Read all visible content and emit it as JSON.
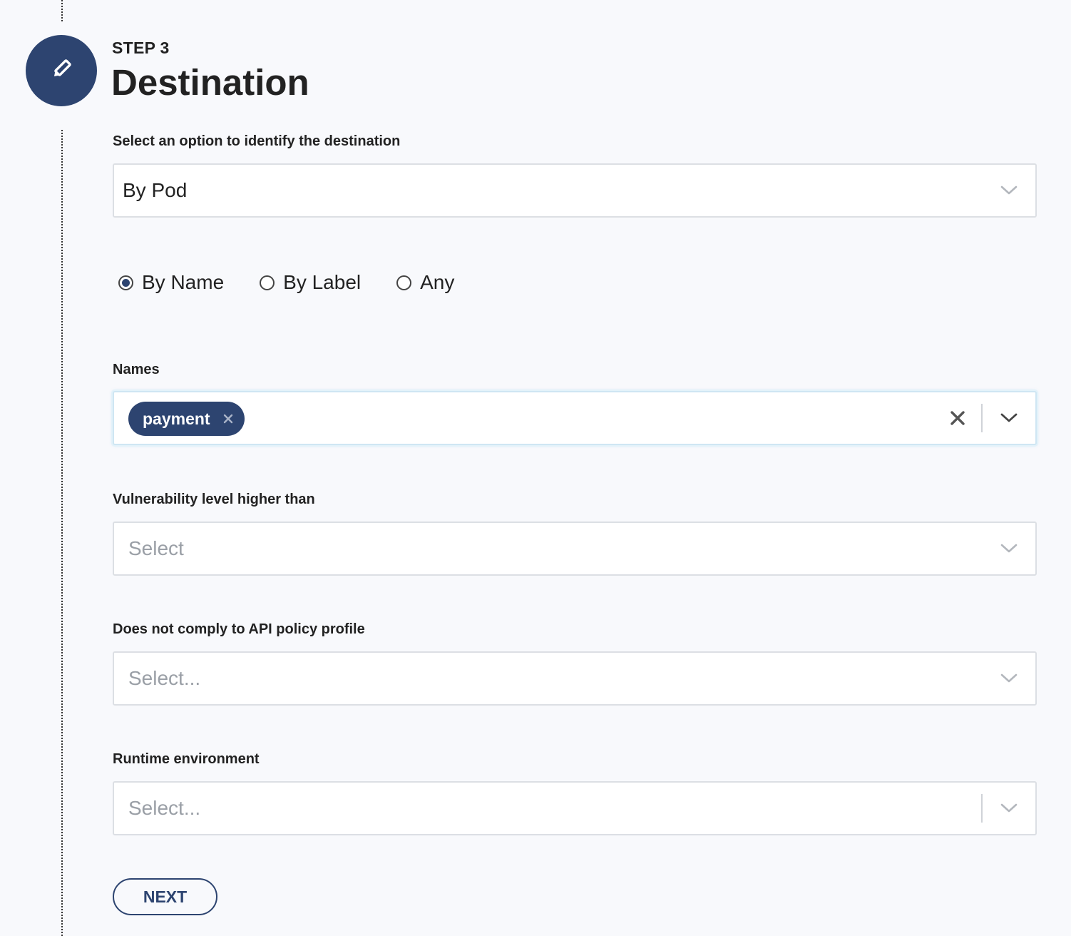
{
  "step": {
    "number_label": "STEP 3",
    "title": "Destination",
    "icon": "pencil-icon"
  },
  "identify": {
    "label": "Select an option to identify the destination",
    "value": "By Pod"
  },
  "radio_options": {
    "by_name": "By Name",
    "by_label": "By Label",
    "any": "Any",
    "selected": "By Name"
  },
  "names": {
    "label": "Names",
    "chips": [
      "payment"
    ]
  },
  "vulnerability": {
    "label": "Vulnerability level higher than",
    "placeholder": "Select"
  },
  "api_policy": {
    "label": "Does not comply to API policy profile",
    "placeholder": "Select..."
  },
  "runtime": {
    "label": "Runtime environment",
    "placeholder": "Select..."
  },
  "actions": {
    "next_label": "NEXT"
  },
  "colors": {
    "accent": "#2d4470",
    "background": "#f8f9fc"
  }
}
